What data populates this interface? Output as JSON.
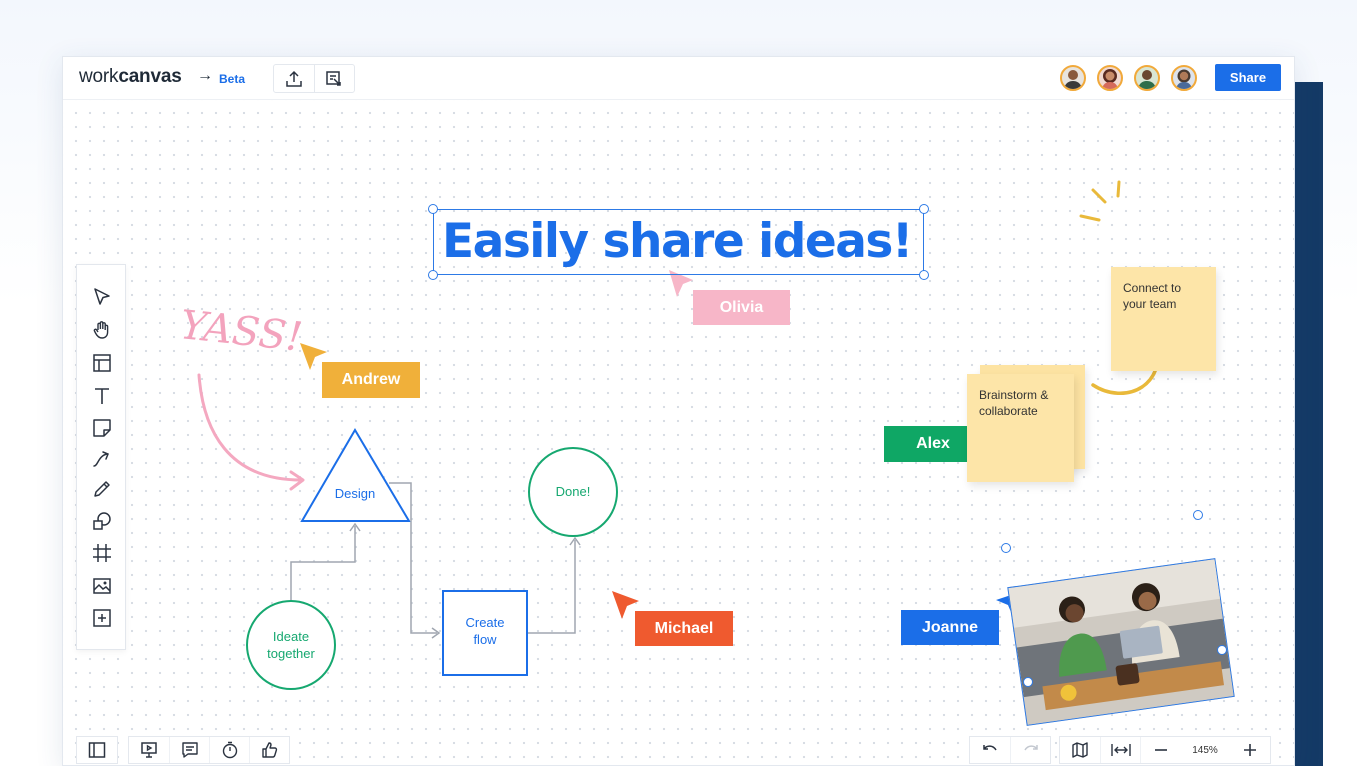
{
  "header": {
    "logo_light": "work",
    "logo_bold": "canvas",
    "logo_arrow": "→",
    "beta_label": "Beta",
    "share_label": "Share",
    "upload_icon": "upload-icon",
    "present_icon": "export-icon"
  },
  "collaborators": [
    {
      "name": "collaborator-1",
      "color": "#f1a93a",
      "skin": "#8a5a3c"
    },
    {
      "name": "collaborator-2",
      "color": "#f1a93a",
      "skin": "#c98c6a"
    },
    {
      "name": "collaborator-3",
      "color": "#f1a93a",
      "skin": "#6b4630"
    },
    {
      "name": "collaborator-4",
      "color": "#f1a93a",
      "skin": "#b07a58"
    }
  ],
  "tools": [
    "select-icon",
    "hand-icon",
    "template-icon",
    "text-icon",
    "sticky-note-icon",
    "connector-icon",
    "pen-icon",
    "shapes-icon",
    "frame-icon",
    "image-icon",
    "add-icon"
  ],
  "canvas": {
    "headline": "Easily share ideas!",
    "handwriting": "YASS!",
    "cursors": {
      "olivia": {
        "name": "Olivia",
        "color": "#f7b6c8"
      },
      "andrew": {
        "name": "Andrew",
        "color": "#f0b03a"
      },
      "alex": {
        "name": "Alex",
        "color": "#0fa765"
      },
      "michael": {
        "name": "Michael",
        "color": "#ef5a2f"
      },
      "joanne": {
        "name": "Joanne",
        "color": "#1b6ee8"
      }
    },
    "flow": {
      "design": "Design",
      "ideate_line1": "Ideate",
      "ideate_line2": "together",
      "create_line1": "Create",
      "create_line2": "flow",
      "done": "Done!"
    },
    "stickies": {
      "brainstorm_line1": "Brainstorm &",
      "brainstorm_line2": "collaborate",
      "connect_line1": "Connect to",
      "connect_line2": "your team"
    }
  },
  "footer": {
    "zoom_level": "145%",
    "left_icons": [
      "sidebar-icon",
      "present-icon",
      "comment-icon",
      "timer-icon",
      "thumbs-up-icon"
    ],
    "right_icons": [
      "undo-icon",
      "redo-icon",
      "map-icon",
      "fit-width-icon",
      "zoom-out-icon",
      "zoom-in-icon"
    ]
  },
  "colors": {
    "accent": "#1b6ee8",
    "green": "#16a870",
    "pink": "#f4a8c0",
    "yellow": "#e9b93a",
    "side_panel": "#143a66"
  }
}
